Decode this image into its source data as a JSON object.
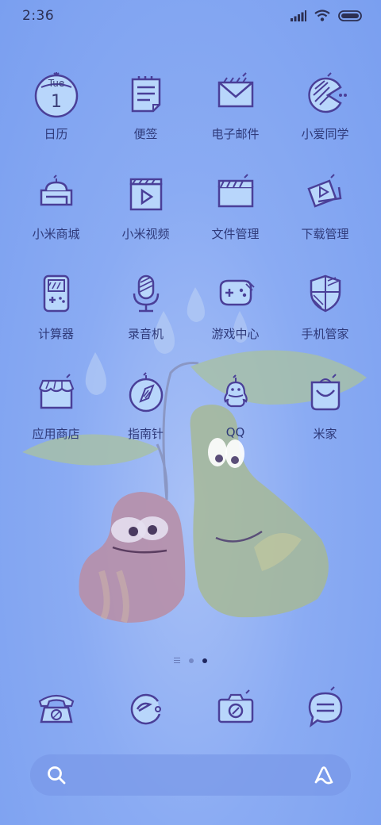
{
  "status": {
    "time": "2:36"
  },
  "apps": [
    {
      "label": "日历",
      "icon": "calendar-icon",
      "day": "Tue",
      "date": "1"
    },
    {
      "label": "便签",
      "icon": "notes-icon"
    },
    {
      "label": "电子邮件",
      "icon": "email-icon"
    },
    {
      "label": "小爱同学",
      "icon": "xiaoai-icon"
    },
    {
      "label": "小米商城",
      "icon": "mi-store-icon"
    },
    {
      "label": "小米视频",
      "icon": "video-icon"
    },
    {
      "label": "文件管理",
      "icon": "file-manager-icon"
    },
    {
      "label": "下载管理",
      "icon": "downloads-icon"
    },
    {
      "label": "计算器",
      "icon": "calculator-icon"
    },
    {
      "label": "录音机",
      "icon": "recorder-icon"
    },
    {
      "label": "游戏中心",
      "icon": "game-center-icon"
    },
    {
      "label": "手机管家",
      "icon": "security-icon"
    },
    {
      "label": "应用商店",
      "icon": "app-store-icon"
    },
    {
      "label": "指南针",
      "icon": "compass-icon"
    },
    {
      "label": "QQ",
      "icon": "qq-icon"
    },
    {
      "label": "米家",
      "icon": "mijia-icon"
    }
  ],
  "dock": [
    {
      "name": "phone",
      "icon": "phone-icon"
    },
    {
      "name": "browser",
      "icon": "browser-icon"
    },
    {
      "name": "camera",
      "icon": "camera-icon"
    },
    {
      "name": "messages",
      "icon": "messages-icon"
    }
  ],
  "page_indicator": {
    "pages": 2,
    "current": 2
  },
  "colors": {
    "stroke": "#4a3f98",
    "fill": "#b8d6fb",
    "bg": "#8aabf3"
  }
}
